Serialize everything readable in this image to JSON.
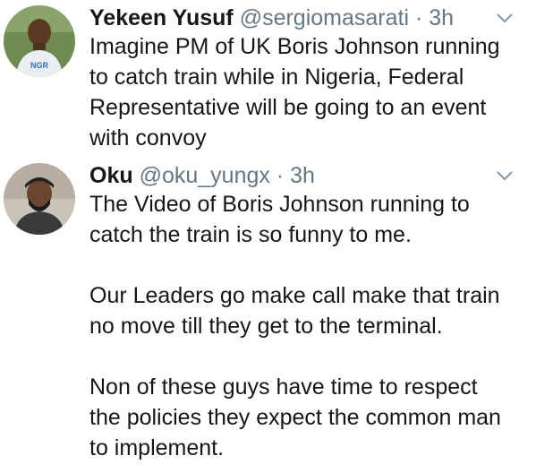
{
  "tweets": [
    {
      "display_name": "Yekeen Yusuf",
      "handle": "@sergiomasarati",
      "separator": "·",
      "time": "3h",
      "avatar_icon": "user-avatar-icon",
      "lines": [
        "Imagine PM of UK Boris Johnson running",
        "to catch train while in Nigeria, Federal",
        "Representative will be going to an event",
        "with convoy"
      ]
    },
    {
      "display_name": "Oku",
      "handle": "@oku_yungx",
      "separator": "·",
      "time": "3h",
      "avatar_icon": "user-avatar-icon",
      "lines": [
        "The Video of Boris Johnson running to",
        "catch the train is so funny to me.",
        "",
        "Our Leaders go make call make that train",
        "no move till they get to the terminal.",
        "",
        "Non of these guys have time to respect",
        "the policies they expect the common man",
        "to implement."
      ]
    }
  ],
  "colors": {
    "text": "#14171a",
    "secondary": "#657786",
    "chevron": "#8899a6"
  }
}
